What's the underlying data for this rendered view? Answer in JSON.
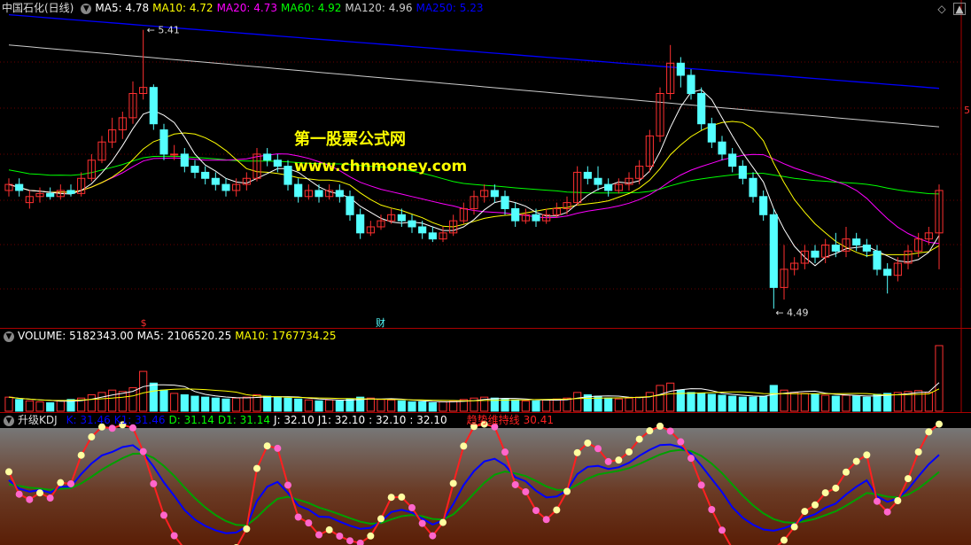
{
  "stock": {
    "name": "中国石化(日线)"
  },
  "price_legend": [
    {
      "label": "MA5: 4.78",
      "color": "#ffffff"
    },
    {
      "label": "MA10: 4.72",
      "color": "#ffff00"
    },
    {
      "label": "MA20: 4.73",
      "color": "#ff00ff"
    },
    {
      "label": "MA60: 4.92",
      "color": "#00ff00"
    },
    {
      "label": "MA120: 4.96",
      "color": "#cccccc"
    },
    {
      "label": "MA250: 5.23",
      "color": "#0000ff"
    }
  ],
  "price_annotations": {
    "high": "5.41",
    "low": "4.49",
    "marker_s": "$",
    "marker_cai": "财",
    "edge_label": "5"
  },
  "watermark": {
    "line1": "第一股票公式网",
    "line2": "www.chnmoney.com"
  },
  "volume_legend": [
    {
      "label": "VOLUME: 5182343.00",
      "color": "#ffffff"
    },
    {
      "label": "MA5: 2106520.25",
      "color": "#ffffff"
    },
    {
      "label": "MA10: 1767734.25",
      "color": "#ffff00"
    }
  ],
  "kdj_legend": {
    "title": "升级KDJ",
    "items": [
      {
        "label": "K: 31.46",
        "color": "#0000ff"
      },
      {
        "label": "K1: 31.46",
        "color": "#0000ff"
      },
      {
        "label": "D: 31.14",
        "color": "#00ff00"
      },
      {
        "label": "D1: 31.14",
        "color": "#00ff00"
      },
      {
        "label": "J: 32.10",
        "color": "#ffffff"
      },
      {
        "label": "J1: 32.10",
        "color": "#ffffff"
      },
      {
        "label": ": 32.10",
        "color": "#ffffff"
      },
      {
        "label": ": 32.10",
        "color": "#ffffff"
      }
    ],
    "trend_label": "趋势维持线",
    "trend_value": "30.41",
    "trend_color": "#ff2020"
  },
  "colors": {
    "up": "#ff3030",
    "down": "#54ffff",
    "axis": "#aa0000"
  },
  "chart_data": {
    "type": "candlestick",
    "price_range": [
      4.45,
      5.45
    ],
    "candles": [
      [
        4.88,
        4.9,
        4.92,
        4.86
      ],
      [
        4.9,
        4.88,
        4.92,
        4.86
      ],
      [
        4.84,
        4.86,
        4.88,
        4.82
      ],
      [
        4.86,
        4.87,
        4.89,
        4.84
      ],
      [
        4.87,
        4.86,
        4.89,
        4.85
      ],
      [
        4.86,
        4.88,
        4.9,
        4.85
      ],
      [
        4.88,
        4.87,
        4.9,
        4.86
      ],
      [
        4.87,
        4.92,
        4.94,
        4.86
      ],
      [
        4.92,
        4.98,
        5.0,
        4.91
      ],
      [
        4.98,
        5.04,
        5.06,
        4.97
      ],
      [
        5.04,
        5.08,
        5.12,
        5.02
      ],
      [
        5.08,
        5.12,
        5.14,
        5.05
      ],
      [
        5.12,
        5.2,
        5.24,
        5.1
      ],
      [
        5.2,
        5.22,
        5.41,
        5.18
      ],
      [
        5.22,
        5.1,
        5.23,
        5.08
      ],
      [
        5.08,
        5.0,
        5.1,
        4.98
      ],
      [
        5.0,
        5.0,
        5.03,
        4.98
      ],
      [
        5.0,
        4.96,
        5.02,
        4.94
      ],
      [
        4.96,
        4.94,
        4.98,
        4.92
      ],
      [
        4.94,
        4.92,
        4.96,
        4.9
      ],
      [
        4.92,
        4.9,
        4.94,
        4.88
      ],
      [
        4.9,
        4.88,
        4.92,
        4.86
      ],
      [
        4.88,
        4.9,
        4.92,
        4.86
      ],
      [
        4.9,
        4.92,
        4.94,
        4.88
      ],
      [
        4.92,
        5.0,
        5.02,
        4.91
      ],
      [
        5.0,
        4.98,
        5.02,
        4.96
      ],
      [
        4.98,
        4.96,
        5.0,
        4.94
      ],
      [
        4.96,
        4.9,
        4.98,
        4.88
      ],
      [
        4.9,
        4.86,
        4.92,
        4.84
      ],
      [
        4.86,
        4.88,
        4.9,
        4.85
      ],
      [
        4.88,
        4.86,
        4.9,
        4.84
      ],
      [
        4.86,
        4.88,
        4.9,
        4.85
      ],
      [
        4.88,
        4.86,
        4.9,
        4.84
      ],
      [
        4.86,
        4.8,
        4.88,
        4.78
      ],
      [
        4.8,
        4.74,
        4.82,
        4.72
      ],
      [
        4.74,
        4.76,
        4.78,
        4.73
      ],
      [
        4.76,
        4.78,
        4.8,
        4.75
      ],
      [
        4.78,
        4.8,
        4.82,
        4.77
      ],
      [
        4.8,
        4.78,
        4.82,
        4.76
      ],
      [
        4.78,
        4.76,
        4.8,
        4.74
      ],
      [
        4.76,
        4.74,
        4.78,
        4.72
      ],
      [
        4.74,
        4.72,
        4.76,
        4.71
      ],
      [
        4.72,
        4.74,
        4.76,
        4.71
      ],
      [
        4.74,
        4.78,
        4.8,
        4.73
      ],
      [
        4.78,
        4.82,
        4.84,
        4.77
      ],
      [
        4.82,
        4.86,
        4.88,
        4.8
      ],
      [
        4.86,
        4.88,
        4.9,
        4.84
      ],
      [
        4.88,
        4.86,
        4.9,
        4.84
      ],
      [
        4.86,
        4.82,
        4.88,
        4.8
      ],
      [
        4.82,
        4.78,
        4.84,
        4.76
      ],
      [
        4.78,
        4.8,
        4.82,
        4.77
      ],
      [
        4.8,
        4.78,
        4.82,
        4.76
      ],
      [
        4.78,
        4.8,
        4.82,
        4.77
      ],
      [
        4.8,
        4.82,
        4.84,
        4.79
      ],
      [
        4.82,
        4.84,
        4.86,
        4.8
      ],
      [
        4.84,
        4.94,
        4.96,
        4.83
      ],
      [
        4.94,
        4.92,
        4.96,
        4.9
      ],
      [
        4.92,
        4.9,
        4.96,
        4.88
      ],
      [
        4.9,
        4.88,
        4.92,
        4.86
      ],
      [
        4.88,
        4.9,
        4.92,
        4.87
      ],
      [
        4.9,
        4.92,
        4.94,
        4.88
      ],
      [
        4.92,
        4.96,
        4.98,
        4.9
      ],
      [
        4.96,
        5.06,
        5.08,
        4.94
      ],
      [
        5.06,
        5.2,
        5.22,
        5.04
      ],
      [
        5.2,
        5.3,
        5.36,
        5.18
      ],
      [
        5.3,
        5.26,
        5.32,
        5.22
      ],
      [
        5.26,
        5.2,
        5.28,
        5.18
      ],
      [
        5.2,
        5.1,
        5.22,
        5.08
      ],
      [
        5.1,
        5.04,
        5.12,
        5.02
      ],
      [
        5.04,
        5.0,
        5.06,
        4.98
      ],
      [
        5.0,
        4.96,
        5.02,
        4.94
      ],
      [
        4.96,
        4.92,
        4.98,
        4.9
      ],
      [
        4.92,
        4.86,
        4.94,
        4.84
      ],
      [
        4.86,
        4.8,
        4.88,
        4.78
      ],
      [
        4.8,
        4.56,
        4.82,
        4.49
      ],
      [
        4.56,
        4.62,
        4.7,
        4.52
      ],
      [
        4.62,
        4.64,
        4.66,
        4.6
      ],
      [
        4.64,
        4.68,
        4.7,
        4.62
      ],
      [
        4.68,
        4.66,
        4.7,
        4.64
      ],
      [
        4.66,
        4.7,
        4.72,
        4.64
      ],
      [
        4.7,
        4.68,
        4.74,
        4.66
      ],
      [
        4.68,
        4.72,
        4.76,
        4.66
      ],
      [
        4.72,
        4.7,
        4.74,
        4.68
      ],
      [
        4.7,
        4.68,
        4.72,
        4.66
      ],
      [
        4.68,
        4.62,
        4.7,
        4.6
      ],
      [
        4.62,
        4.6,
        4.64,
        4.54
      ],
      [
        4.6,
        4.64,
        4.66,
        4.58
      ],
      [
        4.64,
        4.68,
        4.7,
        4.62
      ],
      [
        4.68,
        4.72,
        4.74,
        4.66
      ],
      [
        4.72,
        4.74,
        4.76,
        4.7
      ],
      [
        4.74,
        4.88,
        4.9,
        4.62
      ]
    ],
    "volumes": [
      30,
      25,
      22,
      20,
      18,
      22,
      25,
      28,
      35,
      40,
      45,
      42,
      50,
      85,
      60,
      45,
      38,
      35,
      32,
      30,
      28,
      26,
      28,
      30,
      35,
      32,
      30,
      28,
      26,
      24,
      22,
      24,
      22,
      26,
      30,
      28,
      25,
      24,
      22,
      20,
      20,
      18,
      20,
      22,
      25,
      28,
      30,
      28,
      26,
      24,
      22,
      22,
      24,
      26,
      28,
      40,
      35,
      32,
      28,
      26,
      28,
      30,
      40,
      55,
      60,
      45,
      40,
      38,
      36,
      34,
      32,
      30,
      30,
      32,
      55,
      45,
      40,
      38,
      36,
      34,
      32,
      34,
      32,
      30,
      36,
      38,
      40,
      42,
      44,
      40,
      140
    ]
  }
}
